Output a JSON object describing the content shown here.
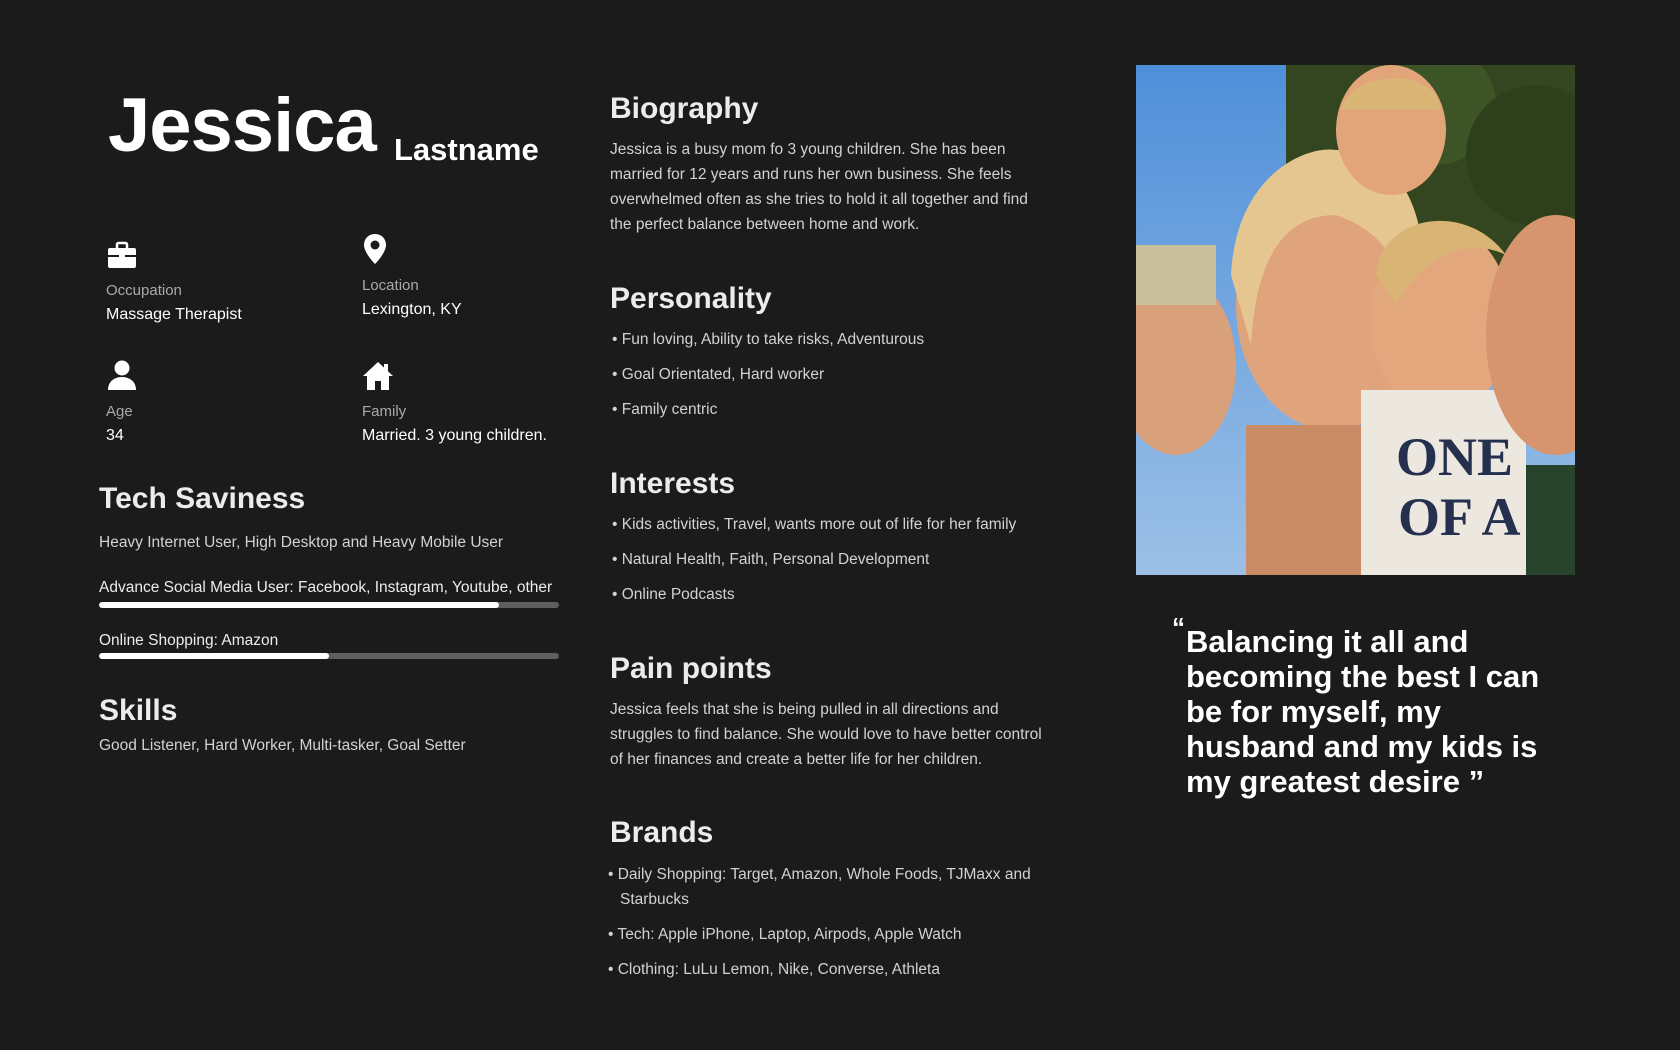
{
  "name": {
    "first": "Jessica",
    "last": "Lastname"
  },
  "info": {
    "occupation": {
      "label": "Occupation",
      "value": "Massage Therapist",
      "icon": "briefcase-icon"
    },
    "location": {
      "label": "Location",
      "value": "Lexington, KY",
      "icon": "map-pin-icon"
    },
    "age": {
      "label": "Age",
      "value": "34",
      "icon": "person-icon"
    },
    "family": {
      "label": "Family",
      "value": "Married. 3 young children.",
      "icon": "home-icon"
    }
  },
  "tech": {
    "title": "Tech Saviness",
    "summary": "Heavy Internet User, High Desktop and Heavy Mobile User",
    "bars": [
      {
        "label": "Advance Social Media User: Facebook, Instagram, Youtube, other",
        "level": 0.87
      },
      {
        "label": "Online Shopping: Amazon",
        "level": 0.5
      }
    ]
  },
  "skills": {
    "title": "Skills",
    "text": "Good Listener, Hard Worker, Multi-tasker, Goal Setter"
  },
  "biography": {
    "title": "Biography",
    "lines": [
      "Jessica is a busy mom fo 3 young children. She has been",
      "married for 12 years and runs her own business. She feels",
      "overwhelmed often as she tries to hold it all together and find",
      "the perfect balance between home and work."
    ]
  },
  "personality": {
    "title": "Personality",
    "items": [
      "Fun loving, Ability to take risks, Adventurous",
      "Goal Orientated, Hard worker",
      "Family centric"
    ]
  },
  "interests": {
    "title": "Interests",
    "items": [
      "Kids activities, Travel, wants more out of life for her family",
      "Natural Health, Faith, Personal Development",
      "Online Podcasts"
    ]
  },
  "pain_points": {
    "title": "Pain points",
    "lines": [
      "Jessica feels that she is being pulled in all directions and",
      "struggles to find balance. She would love to have better control",
      "of her finances and create a better life for her children."
    ]
  },
  "brands": {
    "title": "Brands",
    "items": [
      {
        "line1": "Daily Shopping: Target, Amazon, Whole Foods, TJMaxx and",
        "line2": "Starbucks"
      },
      {
        "line1": "Tech: Apple iPhone, Laptop, Airpods, Apple Watch",
        "line2": ""
      },
      {
        "line1": "Clothing: LuLu Lemon, Nike, Converse, Athleta",
        "line2": ""
      }
    ]
  },
  "quote": {
    "open_mark": "“",
    "lines": [
      "Balancing it all and",
      "becoming the best I can",
      "be for myself, my",
      "husband and my kids is",
      "my greatest desire ”"
    ]
  },
  "colors": {
    "background": "#1b1b1b",
    "text": "#ffffff",
    "muted": "#a9a9a9",
    "track": "#5e5e5e"
  }
}
